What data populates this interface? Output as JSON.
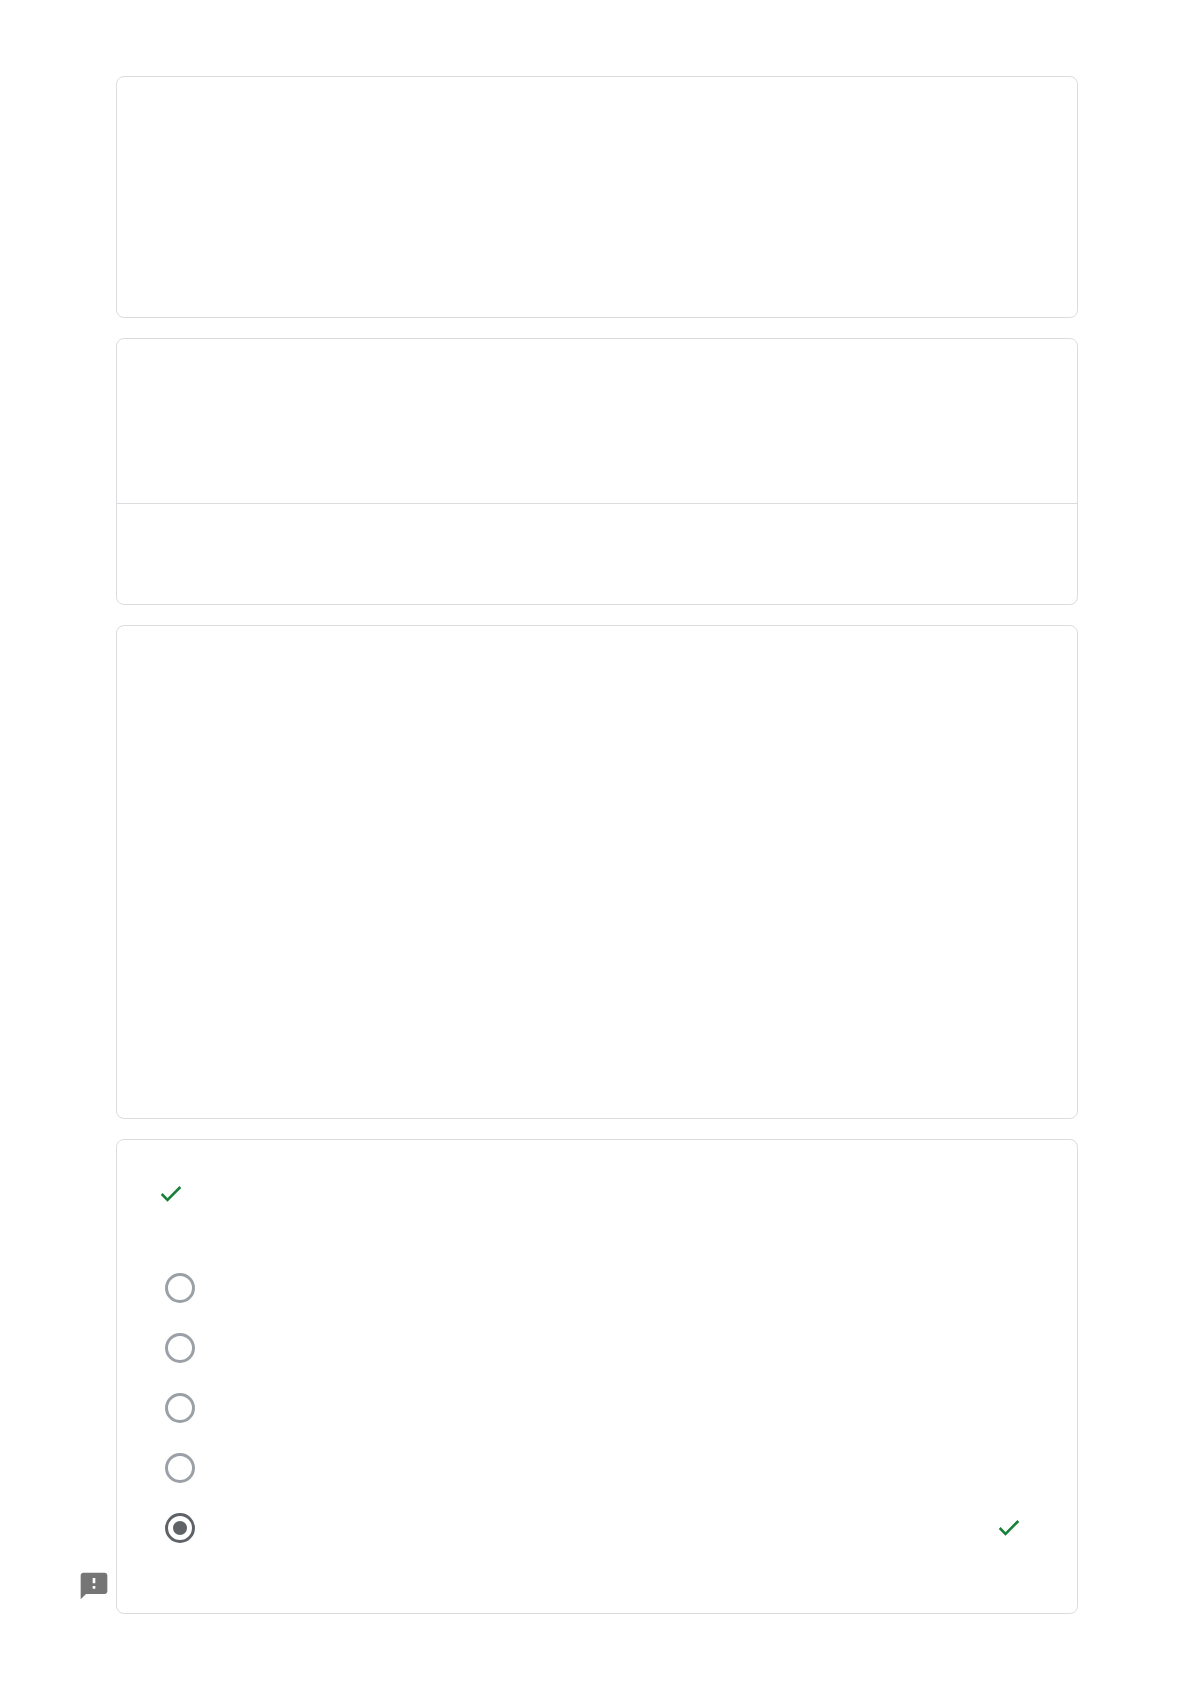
{
  "cards": [
    {
      "kind": "blank"
    },
    {
      "kind": "divided"
    },
    {
      "kind": "tall"
    },
    {
      "kind": "question",
      "correct": true,
      "options": [
        {
          "selected": false,
          "correct": false
        },
        {
          "selected": false,
          "correct": false
        },
        {
          "selected": false,
          "correct": false
        },
        {
          "selected": false,
          "correct": false
        },
        {
          "selected": true,
          "correct": true
        }
      ]
    }
  ]
}
